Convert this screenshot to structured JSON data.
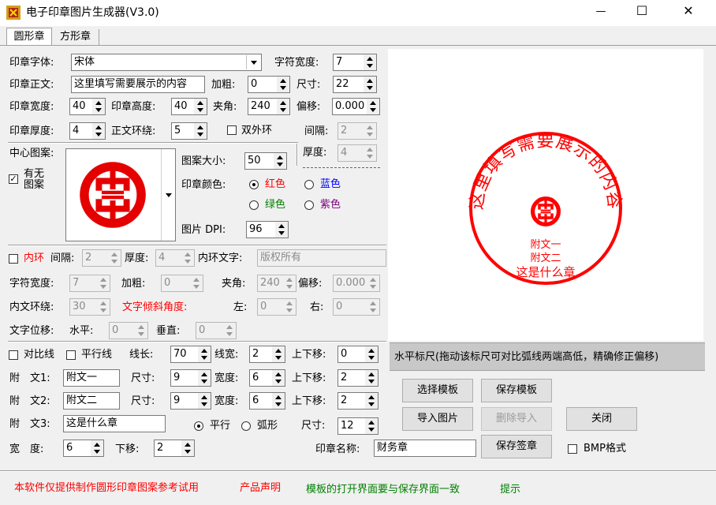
{
  "window": {
    "title": "电子印章图片生成器(V3.0)",
    "controls": {
      "minimize": "—",
      "maximize": "☐",
      "close": "✕"
    }
  },
  "tabs": [
    {
      "label": "圆形章",
      "active": true
    },
    {
      "label": "方形章",
      "active": false
    }
  ],
  "form": {
    "font_label": "印章字体:",
    "font_value": "宋体",
    "char_width_label": "字符宽度:",
    "char_width_value": "7",
    "text_label": "印章正文:",
    "text_value": "这里填写需要展示的内容",
    "bold_label": "加粗:",
    "bold_value": "0",
    "size_label": "尺寸:",
    "size_value": "22",
    "width_label": "印章宽度:",
    "width_value": "40",
    "height_label": "印章高度:",
    "height_value": "40",
    "angle_label": "夹角:",
    "angle_value": "240",
    "offset_label": "偏移:",
    "offset_value": "0.000",
    "thickness_label": "印章厚度:",
    "thickness_value": "4",
    "wrap_label": "正文环绕:",
    "wrap_value": "5",
    "double_ring_label": "双外环",
    "gap_label": "间隔:",
    "gap_value": "2",
    "ring_thick_label": "厚度:",
    "ring_thick_value": "4",
    "center_label": "中心图案:",
    "has_pattern_label_1": "有无",
    "has_pattern_label_2": "图案",
    "pattern_size_label": "图案大小:",
    "pattern_size_value": "50",
    "color_label": "印章颜色:",
    "colors": {
      "red": "红色",
      "blue": "蓝色",
      "green": "绿色",
      "purple": "紫色"
    },
    "dpi_label": "图片 DPI:",
    "dpi_value": "96",
    "inner_ring_label": "内环",
    "inner_gap_label": "间隔:",
    "inner_gap_value": "2",
    "inner_thick_label": "厚度:",
    "inner_thick_value": "4",
    "inner_text_label": "内环文字:",
    "inner_text_value": "版权所有",
    "inner_char_width_label": "字符宽度:",
    "inner_char_width_value": "7",
    "inner_bold_label": "加粗:",
    "inner_bold_value": "0",
    "inner_angle_label": "夹角:",
    "inner_angle_value": "240",
    "inner_offset_label": "偏移:",
    "inner_offset_value": "0.000",
    "inner_wrap_label": "内文环绕:",
    "inner_wrap_value": "30",
    "tilt_label": "文字倾斜角度:",
    "left_label": "左:",
    "left_value": "0",
    "right_label": "右:",
    "right_value": "0",
    "text_shift_label": "文字位移:",
    "horizontal_label": "水平:",
    "horizontal_value": "0",
    "vertical_label": "垂直:",
    "vertical_value": "0",
    "compare_label": "对比线",
    "parallel_line_label": "平行线",
    "line_len_label": "线长:",
    "line_len_value": "70",
    "line_width_label": "线宽:",
    "line_width_value": "2",
    "vshift_label": "上下移:",
    "vshift_value": "0",
    "attach1_label": "附　文1:",
    "attach1_value": "附文一",
    "attach1_size_label": "尺寸:",
    "attach1_size_value": "9",
    "attach1_width_label": "宽度:",
    "attach1_width_value": "6",
    "attach1_shift_label": "上下移:",
    "attach1_shift_value": "2",
    "attach2_label": "附　文2:",
    "attach2_value": "附文二",
    "attach2_size_label": "尺寸:",
    "attach2_size_value": "9",
    "attach2_width_label": "宽度:",
    "attach2_width_value": "6",
    "attach2_shift_label": "上下移:",
    "attach2_shift_value": "2",
    "attach3_label": "附　文3:",
    "attach3_value": "这是什么章",
    "parallel_label": "平行",
    "arc_label": "弧形",
    "attach3_size_label": "尺寸:",
    "attach3_size_value": "12",
    "width2_label": "宽　度:",
    "width2_value": "6",
    "down_label": "下移:",
    "down_value": "2",
    "seal_name_label": "印章名称:",
    "seal_name_value": "财务章"
  },
  "preview": {
    "ring_text": "这里填写需要展示的内容",
    "attach1": "附文一",
    "attach2": "附文二",
    "attach3": "这是什么章",
    "seal_color": "#ff0000"
  },
  "ruler_text": "水平标尺(拖动该标尺可对比弧线两端高低，精确修正偏移)",
  "buttons": {
    "select_template": "选择模板",
    "save_template": "保存模板",
    "import_image": "导入图片",
    "delete_import": "删除导入",
    "close": "关闭",
    "save_seal": "保存签章",
    "bmp_format": "BMP格式"
  },
  "footer": {
    "disclaimer": "本软件仅提供制作圆形印章图案参考试用",
    "statement": "产品声明",
    "template_note": "模板的打开界面要与保存界面一致",
    "tip": "提示"
  }
}
